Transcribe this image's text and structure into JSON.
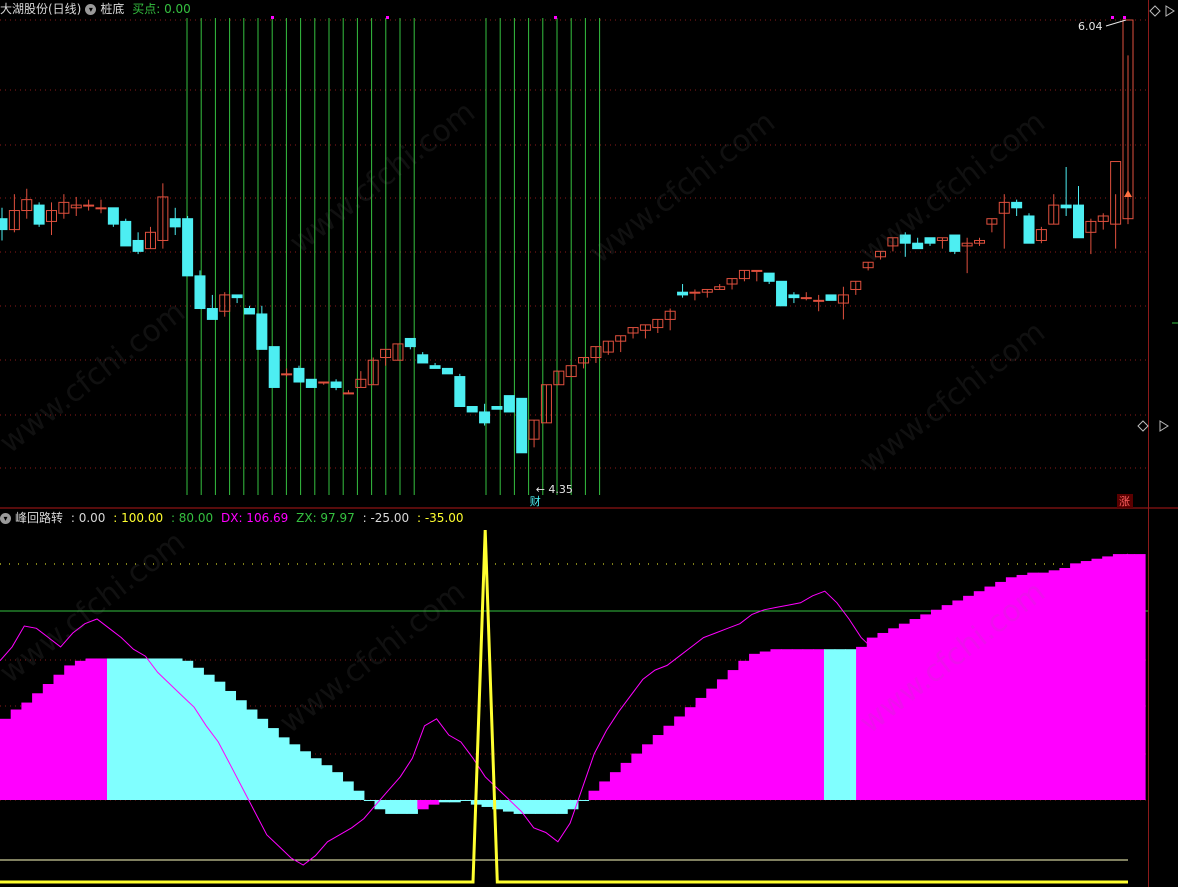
{
  "main_header": {
    "stock": "大湖股份(日线)",
    "indicator": "桩底",
    "buy_label": "买点: 0.00"
  },
  "sub_header": {
    "indicator": "峰回路转",
    "v0": ": 0.00",
    "v1": ": 100.00",
    "v2": ": 80.00",
    "dx": "DX: 106.69",
    "zx": "ZX: 97.97",
    "v3": ": -25.00",
    "v4": ": -35.00"
  },
  "marks": {
    "low_label": "4.35",
    "high_label": "6.04",
    "cai": "财",
    "zhang": "涨"
  },
  "watermark": "www.cfchi.com",
  "colors": {
    "up": "#e0503e",
    "down": "#4deef2",
    "grid": "#8b1a1a",
    "green": "#35c040",
    "magenta": "#ff00ff",
    "cyan_fill": "#80ffff",
    "yellow": "#ffff30"
  },
  "chart_data": [
    {
      "type": "candlestick",
      "title": "大湖股份(日线)",
      "y_range": [
        4.35,
        6.04
      ],
      "candles_ohlc": [
        [
          5.31,
          5.35,
          5.23,
          5.27
        ],
        [
          5.27,
          5.4,
          5.26,
          5.34
        ],
        [
          5.34,
          5.42,
          5.31,
          5.38
        ],
        [
          5.36,
          5.37,
          5.28,
          5.29
        ],
        [
          5.3,
          5.37,
          5.25,
          5.34
        ],
        [
          5.33,
          5.4,
          5.31,
          5.37
        ],
        [
          5.35,
          5.39,
          5.32,
          5.36
        ],
        [
          5.36,
          5.38,
          5.34,
          5.36
        ],
        [
          5.35,
          5.38,
          5.33,
          5.35
        ],
        [
          5.35,
          5.35,
          5.28,
          5.29
        ],
        [
          5.3,
          5.31,
          5.21,
          5.21
        ],
        [
          5.23,
          5.26,
          5.18,
          5.19
        ],
        [
          5.2,
          5.28,
          5.2,
          5.26
        ],
        [
          5.23,
          5.44,
          5.2,
          5.39
        ],
        [
          5.31,
          5.35,
          5.25,
          5.28
        ],
        [
          5.31,
          5.32,
          5.1,
          5.1
        ],
        [
          5.1,
          5.12,
          4.98,
          4.98
        ],
        [
          4.98,
          5.03,
          4.95,
          4.94
        ],
        [
          4.97,
          5.04,
          4.95,
          5.03
        ],
        [
          5.03,
          5.03,
          5.0,
          5.02
        ],
        [
          4.98,
          4.99,
          4.96,
          4.96
        ],
        [
          4.96,
          4.99,
          4.83,
          4.83
        ],
        [
          4.84,
          4.84,
          4.69,
          4.69
        ],
        [
          4.74,
          4.76,
          4.73,
          4.74
        ],
        [
          4.76,
          4.77,
          4.71,
          4.71
        ],
        [
          4.72,
          4.72,
          4.69,
          4.69
        ],
        [
          4.71,
          4.71,
          4.7,
          4.71
        ],
        [
          4.71,
          4.72,
          4.68,
          4.69
        ],
        [
          4.67,
          4.68,
          4.67,
          4.67
        ],
        [
          4.69,
          4.75,
          4.69,
          4.72
        ],
        [
          4.7,
          4.8,
          4.7,
          4.79
        ],
        [
          4.8,
          4.83,
          4.77,
          4.83
        ],
        [
          4.79,
          4.85,
          4.79,
          4.85
        ],
        [
          4.87,
          4.87,
          4.83,
          4.84
        ],
        [
          4.81,
          4.82,
          4.78,
          4.78
        ],
        [
          4.77,
          4.78,
          4.76,
          4.76
        ],
        [
          4.76,
          4.76,
          4.75,
          4.74
        ],
        [
          4.73,
          4.74,
          4.62,
          4.62
        ],
        [
          4.62,
          4.62,
          4.62,
          4.6
        ],
        [
          4.6,
          4.63,
          4.55,
          4.56
        ],
        [
          4.62,
          4.62,
          4.61,
          4.61
        ],
        [
          4.66,
          4.66,
          4.6,
          4.6
        ],
        [
          4.65,
          4.65,
          4.45,
          4.45
        ],
        [
          4.5,
          4.57,
          4.47,
          4.57
        ],
        [
          4.56,
          4.7,
          4.56,
          4.7
        ],
        [
          4.7,
          4.75,
          4.7,
          4.75
        ],
        [
          4.73,
          4.77,
          4.73,
          4.77
        ],
        [
          4.78,
          4.8,
          4.76,
          4.8
        ],
        [
          4.8,
          4.84,
          4.78,
          4.84
        ],
        [
          4.82,
          4.86,
          4.81,
          4.86
        ],
        [
          4.86,
          4.88,
          4.82,
          4.88
        ],
        [
          4.89,
          4.91,
          4.87,
          4.91
        ],
        [
          4.9,
          4.92,
          4.87,
          4.92
        ],
        [
          4.91,
          4.94,
          4.89,
          4.94
        ],
        [
          4.94,
          4.98,
          4.9,
          4.97
        ],
        [
          5.04,
          5.07,
          5.02,
          5.03
        ],
        [
          5.04,
          5.05,
          5.01,
          5.04
        ],
        [
          5.04,
          5.05,
          5.02,
          5.05
        ],
        [
          5.05,
          5.07,
          5.05,
          5.06
        ],
        [
          5.07,
          5.09,
          5.05,
          5.09
        ],
        [
          5.09,
          5.12,
          5.08,
          5.12
        ],
        [
          5.12,
          5.12,
          5.08,
          5.12
        ],
        [
          5.11,
          5.11,
          5.07,
          5.08
        ],
        [
          5.08,
          5.08,
          4.99,
          4.99
        ],
        [
          5.03,
          5.04,
          5.0,
          5.02
        ],
        [
          5.02,
          5.04,
          5.01,
          5.02
        ],
        [
          5.01,
          5.03,
          4.97,
          5.01
        ],
        [
          5.03,
          5.03,
          5.01,
          5.01
        ],
        [
          5.0,
          5.06,
          4.94,
          5.03
        ],
        [
          5.05,
          5.08,
          5.03,
          5.08
        ],
        [
          5.13,
          5.15,
          5.12,
          5.15
        ],
        [
          5.17,
          5.19,
          5.16,
          5.19
        ],
        [
          5.21,
          5.24,
          5.19,
          5.24
        ],
        [
          5.25,
          5.26,
          5.17,
          5.22
        ],
        [
          5.22,
          5.24,
          5.2,
          5.2
        ],
        [
          5.24,
          5.24,
          5.21,
          5.22
        ],
        [
          5.23,
          5.24,
          5.2,
          5.24
        ],
        [
          5.25,
          5.25,
          5.18,
          5.19
        ],
        [
          5.21,
          5.24,
          5.11,
          5.22
        ],
        [
          5.22,
          5.24,
          5.21,
          5.23
        ],
        [
          5.29,
          5.31,
          5.26,
          5.31
        ],
        [
          5.33,
          5.4,
          5.2,
          5.37
        ],
        [
          5.37,
          5.38,
          5.32,
          5.35
        ],
        [
          5.32,
          5.33,
          5.22,
          5.22
        ],
        [
          5.23,
          5.28,
          5.22,
          5.27
        ],
        [
          5.29,
          5.4,
          5.29,
          5.36
        ],
        [
          5.36,
          5.5,
          5.32,
          5.35
        ],
        [
          5.36,
          5.43,
          5.24,
          5.24
        ],
        [
          5.26,
          5.31,
          5.18,
          5.3
        ],
        [
          5.3,
          5.33,
          5.27,
          5.32
        ],
        [
          5.29,
          5.4,
          5.2,
          5.52
        ],
        [
          5.31,
          5.91,
          5.29,
          6.04
        ]
      ],
      "markers": {
        "low": 4.35,
        "high": 6.04
      }
    },
    {
      "type": "area",
      "title": "峰回路转",
      "reference_lines": [
        100,
        80,
        -25,
        -35
      ],
      "values": {
        "DX": 106.69,
        "ZX": 97.97
      },
      "series": [
        {
          "name": "DX",
          "kind": "bars",
          "values": [
            35,
            39,
            42,
            46,
            50,
            54,
            58,
            60,
            61,
            61,
            61,
            61,
            61,
            61,
            61,
            61,
            61,
            60,
            57,
            54,
            51,
            47,
            43,
            39,
            35,
            31,
            27,
            24,
            21,
            18,
            15,
            12,
            8,
            4,
            0,
            -4,
            -6,
            -6,
            -6,
            -4,
            -2,
            -1,
            -1,
            0,
            -2,
            -3,
            -4,
            -5,
            -6,
            -6,
            -6,
            -6,
            -6,
            -4,
            0,
            4,
            8,
            12,
            16,
            20,
            24,
            28,
            32,
            36,
            40,
            44,
            48,
            52,
            56,
            60,
            63,
            64,
            65,
            65,
            65,
            65,
            65,
            65,
            65,
            65,
            66,
            70,
            72,
            74,
            76,
            78,
            80,
            82,
            84,
            86,
            88,
            90,
            92,
            94,
            96,
            97,
            98,
            98,
            99,
            100,
            102,
            103,
            104,
            105,
            106,
            106,
            106
          ],
          "colors": "magenta until index 10, cyan 10–38, magenta 38–40, cyan 41–54, magenta 55–76, cyan 77–79, magenta thereafter"
        },
        {
          "name": "ZX",
          "kind": "line",
          "values": [
            60,
            66,
            75,
            74,
            70,
            66,
            72,
            76,
            78,
            74,
            70,
            65,
            62,
            55,
            50,
            45,
            40,
            32,
            25,
            15,
            5,
            -5,
            -15,
            -20,
            -25,
            -28,
            -24,
            -18,
            -15,
            -12,
            -8,
            -2,
            4,
            10,
            18,
            32,
            35,
            28,
            25,
            18,
            10,
            5,
            0,
            -5,
            -12,
            -14,
            -18,
            -10,
            5,
            20,
            30,
            38,
            45,
            52,
            56,
            58,
            62,
            66,
            70,
            72,
            74,
            76,
            80,
            82,
            83,
            84,
            85,
            88,
            90,
            85,
            78,
            70,
            65,
            66,
            68,
            69,
            70,
            70,
            72,
            76,
            80,
            84,
            86,
            88,
            90,
            92,
            94,
            96,
            97,
            98,
            100,
            102,
            104,
            106
          ]
        },
        {
          "name": "yellow",
          "kind": "line",
          "values": [
            -35,
            -35,
            -35,
            -35,
            -35,
            -35,
            -35,
            -35,
            -35,
            -35,
            -35,
            -35,
            -35,
            -35,
            -35,
            -35,
            -35,
            -35,
            -35,
            -35,
            -35,
            -35,
            -35,
            -35,
            -35,
            -35,
            -35,
            -35,
            -35,
            -35,
            -35,
            -35,
            -35,
            -35,
            -35,
            -35,
            -35,
            -35,
            -35,
            -35,
            110,
            -35,
            -35,
            -35,
            -35,
            -35,
            -35,
            -35,
            -35,
            -35,
            -35,
            -35,
            -35,
            -35,
            -35,
            -35,
            -35,
            -35,
            -35,
            -35,
            -35,
            -35,
            -35,
            -35,
            -35,
            -35,
            -35,
            -35,
            -35,
            -35,
            -35,
            -35,
            -35,
            -35,
            -35,
            -35,
            -35,
            -35,
            -35,
            -35,
            -35,
            -35,
            -35,
            -35,
            -35,
            -35,
            -35,
            -35,
            -35,
            -35,
            -35,
            -35,
            -35,
            -35
          ]
        }
      ]
    }
  ]
}
